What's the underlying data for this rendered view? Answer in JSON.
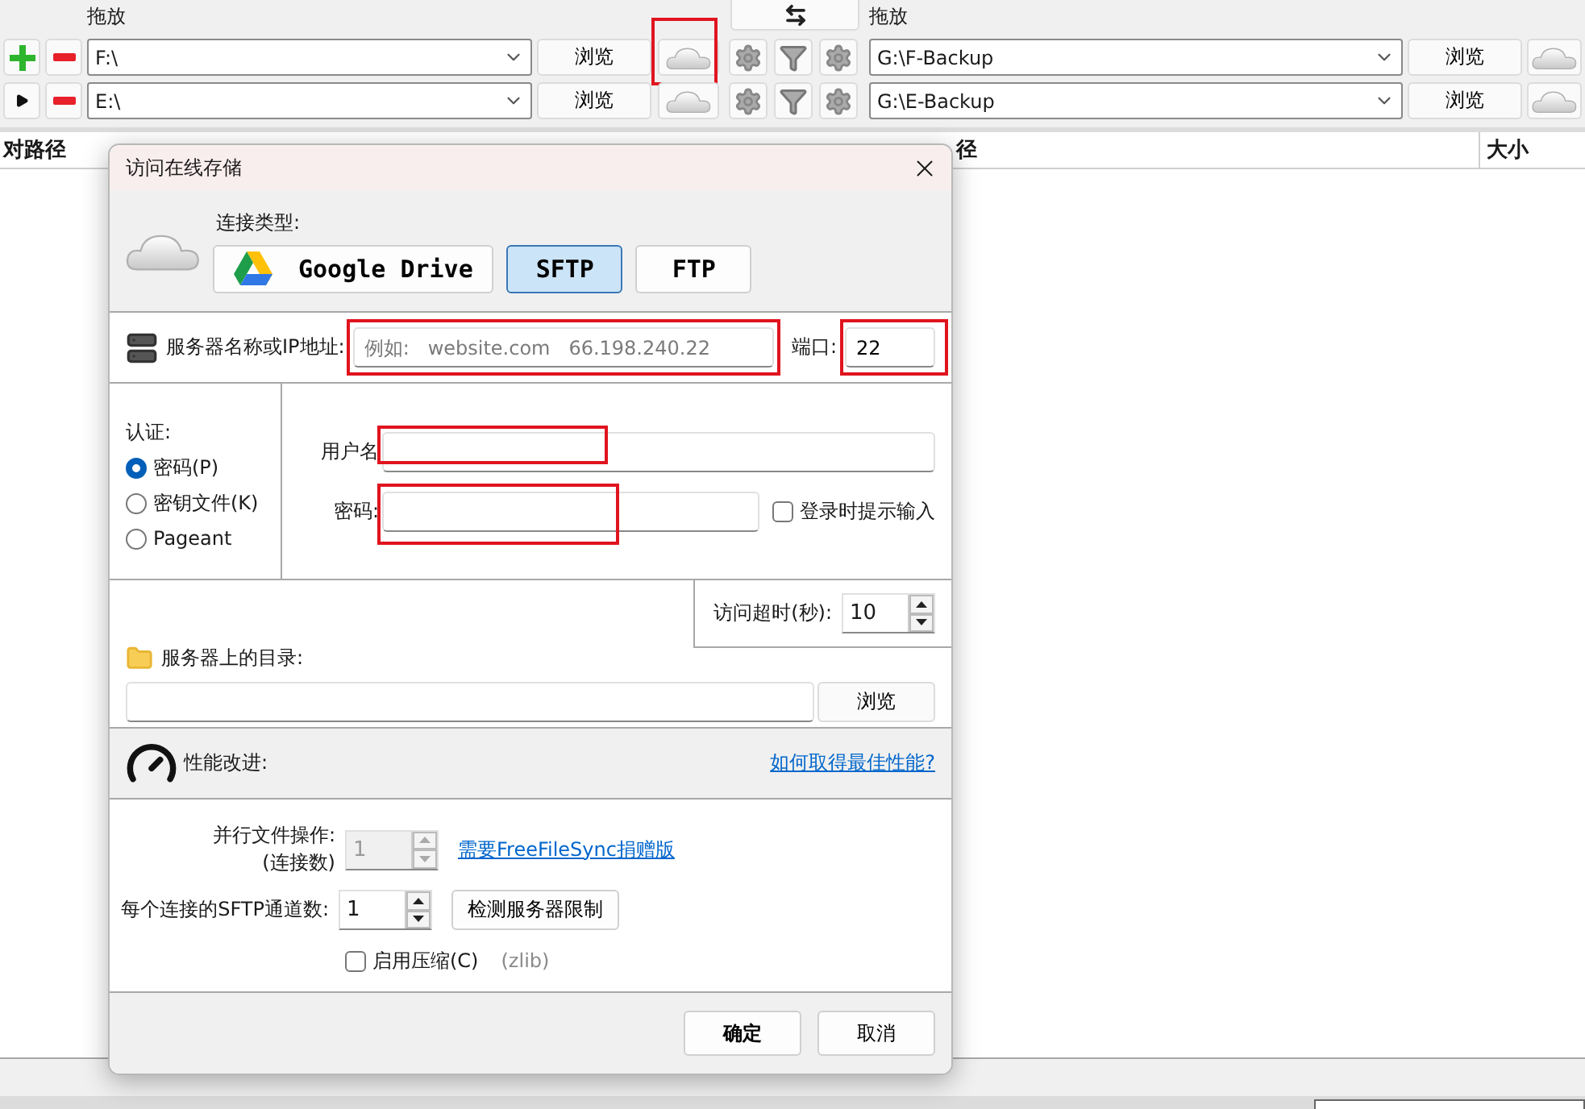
{
  "top_bar": {
    "left_label": "拖放",
    "right_label": "拖放"
  },
  "folder_pairs": [
    {
      "kind": "main",
      "left_path": "F:\\",
      "left_browse": "浏览",
      "cloud_highlighted": true,
      "right_path": "G:\\F-Backup",
      "right_browse": "浏览"
    },
    {
      "kind": "extra",
      "left_path": "E:\\",
      "left_browse": "浏览",
      "cloud_highlighted": false,
      "right_path": "G:\\E-Backup",
      "right_browse": "浏览"
    }
  ],
  "file_list": {
    "left_columns": [
      "对路径"
    ],
    "right_columns": [
      "径",
      "大小"
    ]
  },
  "dialog": {
    "title": "访问在线存储",
    "connection_type_label": "连接类型:",
    "connection_types": [
      {
        "label": "Google Drive",
        "kind": "gdrive",
        "selected": false
      },
      {
        "label": "SFTP",
        "kind": "plain",
        "selected": true
      },
      {
        "label": "FTP",
        "kind": "plain",
        "selected": false
      }
    ],
    "server": {
      "label": "服务器名称或IP地址:",
      "placeholder": "例如:   website.com   66.198.240.22",
      "highlighted": true
    },
    "port": {
      "label": "端口:",
      "value": "22",
      "highlighted": true
    },
    "auth": {
      "label": "认证:",
      "options": [
        {
          "label": "密码(P)",
          "selected": true
        },
        {
          "label": "密钥文件(K)",
          "selected": false
        },
        {
          "label": "Pageant",
          "selected": false
        }
      ]
    },
    "username": {
      "label": "用户名",
      "highlighted": true
    },
    "password": {
      "label": "密码:",
      "highlighted": true
    },
    "prompt_on_login": {
      "label": "登录时提示输入",
      "checked": false
    },
    "timeout": {
      "label": "访问超时(秒):",
      "value": "10"
    },
    "directory": {
      "label": "服务器上的目录:",
      "browse": "浏览"
    },
    "performance": {
      "label": "性能改进:",
      "help_link": "如何取得最佳性能?"
    },
    "parallel_ops": {
      "label_lines": [
        "并行文件操作:",
        "(连接数)"
      ],
      "value": "1",
      "disabled": true,
      "link": "需要FreeFileSync捐赠版"
    },
    "channels": {
      "label": "每个连接的SFTP通道数:",
      "value": "1",
      "disabled": false,
      "button": "检测服务器限制"
    },
    "compression": {
      "label": "启用压缩(C)",
      "checked": false,
      "note": "(zlib)"
    },
    "buttons": [
      {
        "label": "确定",
        "kind": "primary"
      },
      {
        "label": "取消",
        "kind": "normal"
      }
    ]
  }
}
